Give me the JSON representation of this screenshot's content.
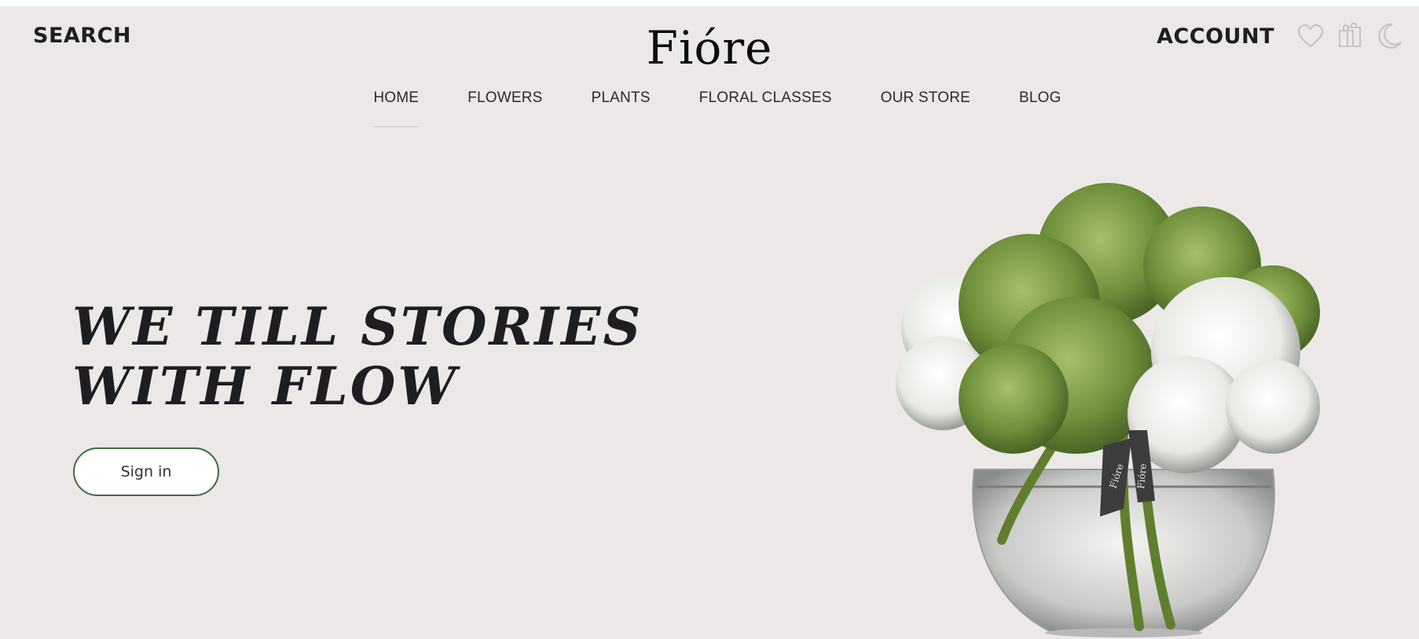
{
  "header": {
    "search_label": "SEARCH",
    "logo": "Fióre",
    "account_label": "ACCOUNT",
    "icons": [
      "heart-icon",
      "shopping-bag-icon",
      "moon-icon"
    ]
  },
  "nav": {
    "items": [
      {
        "label": "HOME",
        "active": true
      },
      {
        "label": "FLOWERS",
        "active": false
      },
      {
        "label": "PLANTS",
        "active": false
      },
      {
        "label": "FLORAL CLASSES",
        "active": false
      },
      {
        "label": "OUR STORE",
        "active": false
      },
      {
        "label": "BLOG",
        "active": false
      }
    ]
  },
  "hero": {
    "headline_line1": "WE TILL STORIES",
    "headline_line2": "WITH FLOW",
    "cta_label": "Sign in",
    "ribbon_text": "Fióre"
  },
  "colors": {
    "background": "#ebe8e7",
    "text": "#1f1f1f",
    "button_border": "#3d6b45",
    "hydrangea_green": "#6f8f3a",
    "hydrangea_white": "#f1f1ee"
  }
}
